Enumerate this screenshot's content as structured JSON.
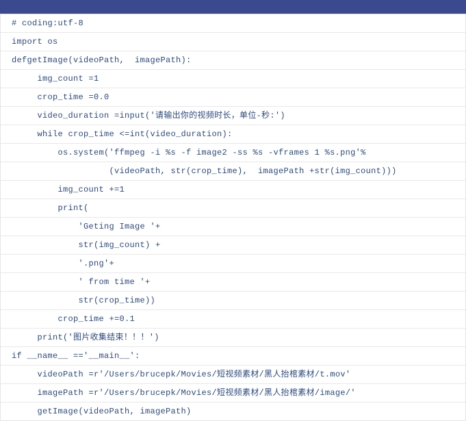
{
  "code": {
    "lines": [
      "# coding:utf-8",
      "import os",
      "defgetImage(videoPath,  imagePath):",
      "     img_count =1",
      "     crop_time =0.0",
      "     video_duration =input('请输出你的视频时长，单位-秒:')",
      "     while crop_time <=int(video_duration):",
      "         os.system('ffmpeg -i %s -f image2 -ss %s -vframes 1 %s.png'%",
      "                   (videoPath, str(crop_time),  imagePath +str(img_count)))",
      "         img_count +=1",
      "         print(",
      "             'Geting Image '+",
      "             str(img_count) +",
      "             '.png'+",
      "             ' from time '+",
      "             str(crop_time))",
      "         crop_time +=0.1",
      "     print('图片收集结束！！！')",
      "if __name__ =='__main__':",
      "     videoPath =r'/Users/brucepk/Movies/短视频素材/黑人抬棺素材/t.mov'",
      "     imagePath =r'/Users/brucepk/Movies/短视频素材/黑人抬棺素材/image/'",
      "     getImage(videoPath, imagePath)"
    ]
  }
}
